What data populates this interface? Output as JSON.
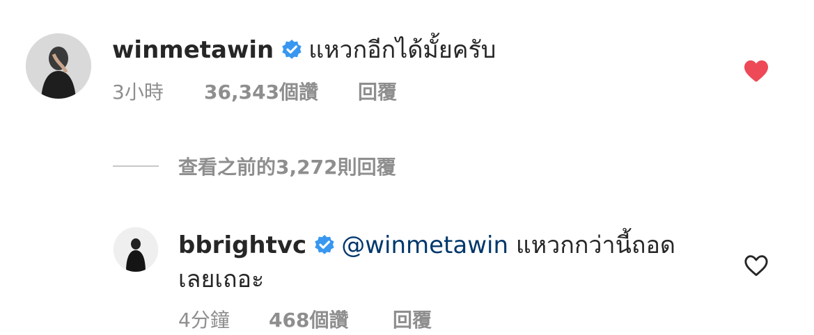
{
  "comment": {
    "username": "winmetawin",
    "text": "แหวกอีกได้มั้ยครับ",
    "time": "3小時",
    "likes": "36,343個讚",
    "reply_label": "回覆",
    "liked": true,
    "heart_color": "#ed4956"
  },
  "view_replies": {
    "label": "查看之前的3,272則回覆"
  },
  "reply": {
    "username": "bbrightvc",
    "mention": "@winmetawin",
    "text_line1": "แหวกกว่านี้ถอด",
    "text_line2": "เลยเถอะ",
    "time": "4分鐘",
    "likes": "468個讚",
    "reply_label": "回覆",
    "liked": false
  },
  "colors": {
    "verified_badge": "#3897f0",
    "mention": "#00376b",
    "meta_text": "#8e8e8e"
  },
  "icons": {
    "verified": "verified-badge-icon",
    "like_filled": "heart-filled-icon",
    "like_outline": "heart-outline-icon"
  }
}
